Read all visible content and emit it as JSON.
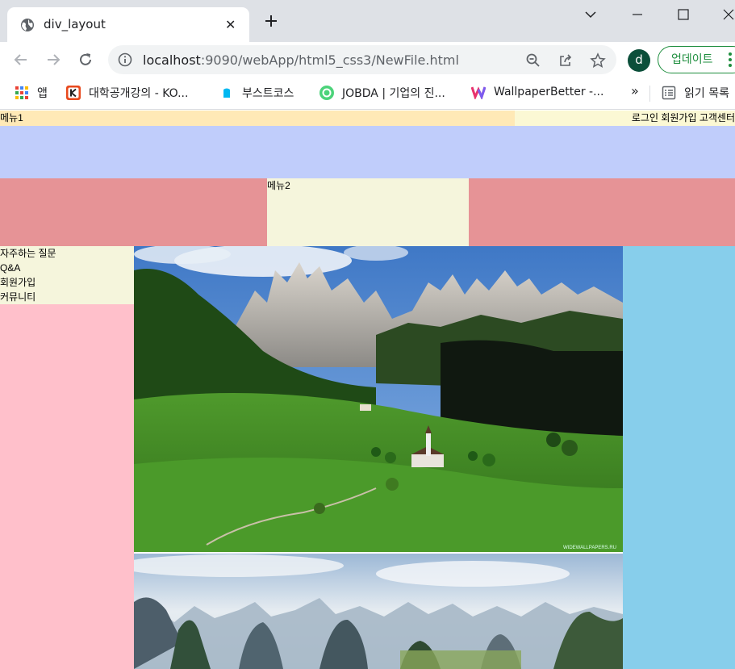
{
  "browser": {
    "tab": {
      "title": "div_layout",
      "favicon": "globe-icon",
      "close_glyph": "✕"
    },
    "window_controls": [
      "chevron-down-icon",
      "minimize-icon",
      "maximize-icon",
      "close-icon"
    ],
    "address": {
      "host": "localhost",
      "path": ":9090/webApp/html5_css3/NewFile.html"
    },
    "profile_initial": "d",
    "update_label": "업데이트",
    "bookmarks": [
      {
        "label": "앱",
        "icon": "apps-grid-icon"
      },
      {
        "label": "대학공개강의 - KO...",
        "icon": "kocw-icon"
      },
      {
        "label": "부스트코스",
        "icon": "boostcourse-icon"
      },
      {
        "label": "JOBDA | 기업의 진...",
        "icon": "jobda-icon"
      },
      {
        "label": "WallpaperBetter -...",
        "icon": "wallpaperbetter-icon"
      }
    ],
    "bookmarks_overflow": "»",
    "reading_list_label": "읽기 목록"
  },
  "page": {
    "menu1": "메뉴1",
    "top_links": "로그인 회원가입 고객센터",
    "menu2": "메뉴2",
    "sidebar_items": [
      "자주하는 질문",
      "Q&A",
      "회원가입",
      "커뮤니티"
    ],
    "image1_watermark": "WIDEWALLPAPERS.RU",
    "colors": {
      "top_left": "#ffe9b6",
      "top_right": "#fbf8d4",
      "banner": "#c0cdfb",
      "nav_row": "#e69396",
      "beige": "#f5f5dc",
      "sidebar": "#ffc0cb",
      "right_col": "#87ceeb"
    }
  }
}
